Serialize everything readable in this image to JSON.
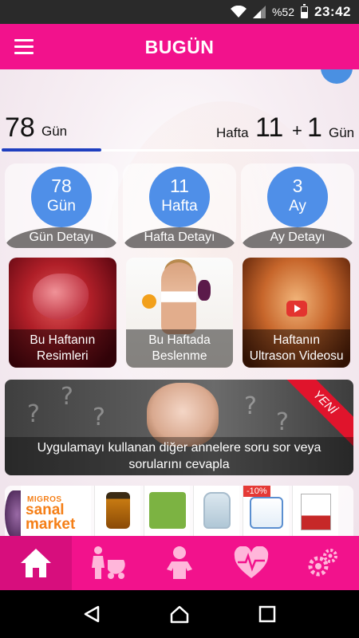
{
  "status_bar": {
    "battery": "%52",
    "time": "23:42"
  },
  "header": {
    "title": "BUGÜN"
  },
  "counter": {
    "days_value": "78",
    "days_unit": "Gün",
    "week_label": "Hafta",
    "week_value": "11",
    "plus": "+",
    "extra_days_value": "1",
    "extra_days_unit": "Gün",
    "progress_fraction": 0.28
  },
  "stat_cards": [
    {
      "value": "78",
      "unit": "Gün",
      "label": "Gün Detayı"
    },
    {
      "value": "11",
      "unit": "Hafta",
      "label": "Hafta Detayı"
    },
    {
      "value": "3",
      "unit": "Ay",
      "label": "Ay Detayı"
    }
  ],
  "tiles": [
    {
      "line1": "Bu Haftanın",
      "line2": "Resimleri"
    },
    {
      "line1": "Bu Haftada",
      "line2": "Beslenme"
    },
    {
      "line1": "Haftanın",
      "line2": "Ultrason Videosu"
    }
  ],
  "banner": {
    "ribbon": "YENİ",
    "line1": "Uygulamayı kullanan diğer annelere soru sor veya",
    "line2": "sorularını cevapla"
  },
  "ad": {
    "brand_top": "MIGROS",
    "brand_line1": "sanal",
    "brand_line2": "market",
    "discount": "-10%"
  },
  "colors": {
    "primary": "#f2128c",
    "stat_circle": "#4f8fe8",
    "progress": "#1f3fbf"
  },
  "icons": {
    "nav": [
      "home-icon",
      "mother-stroller-icon",
      "baby-icon",
      "heart-pulse-icon",
      "gears-icon"
    ],
    "system": [
      "back-icon",
      "home-circle-icon",
      "recents-icon"
    ]
  }
}
